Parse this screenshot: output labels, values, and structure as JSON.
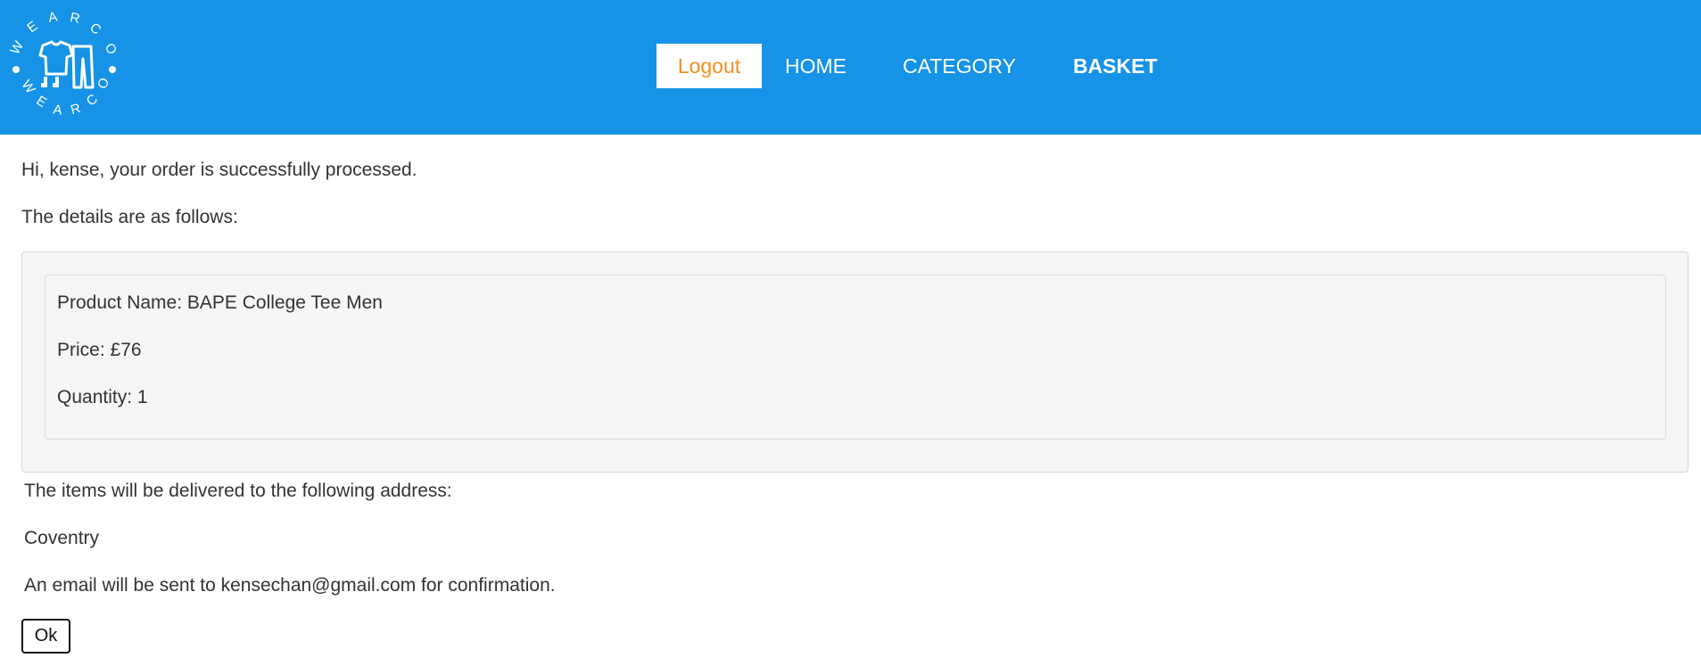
{
  "header": {
    "logo": {
      "letters_top": [
        "W",
        "E",
        "A",
        "R",
        "C",
        "O"
      ],
      "letters_bottom": [
        "W",
        "E",
        "A",
        "R",
        "C",
        "O"
      ]
    },
    "nav": {
      "logout": "Logout",
      "home": "HOME",
      "category": "CATEGORY",
      "basket": "BASKET"
    },
    "colors": {
      "bar": "#1693e6",
      "logout_text": "#f0901f"
    }
  },
  "main": {
    "greeting": "Hi, kense, your order is successfully processed.",
    "details_intro": "The details are as follows:",
    "item": {
      "product_name": "Product Name: BAPE College Tee Men",
      "price": "Price: £76",
      "quantity": "Quantity: 1"
    },
    "delivery_intro": "The items will be delivered to the following address:",
    "address": "Coventry",
    "email_notice": "An email will be sent to kensechan@gmail.com for confirmation.",
    "ok_label": "Ok"
  }
}
